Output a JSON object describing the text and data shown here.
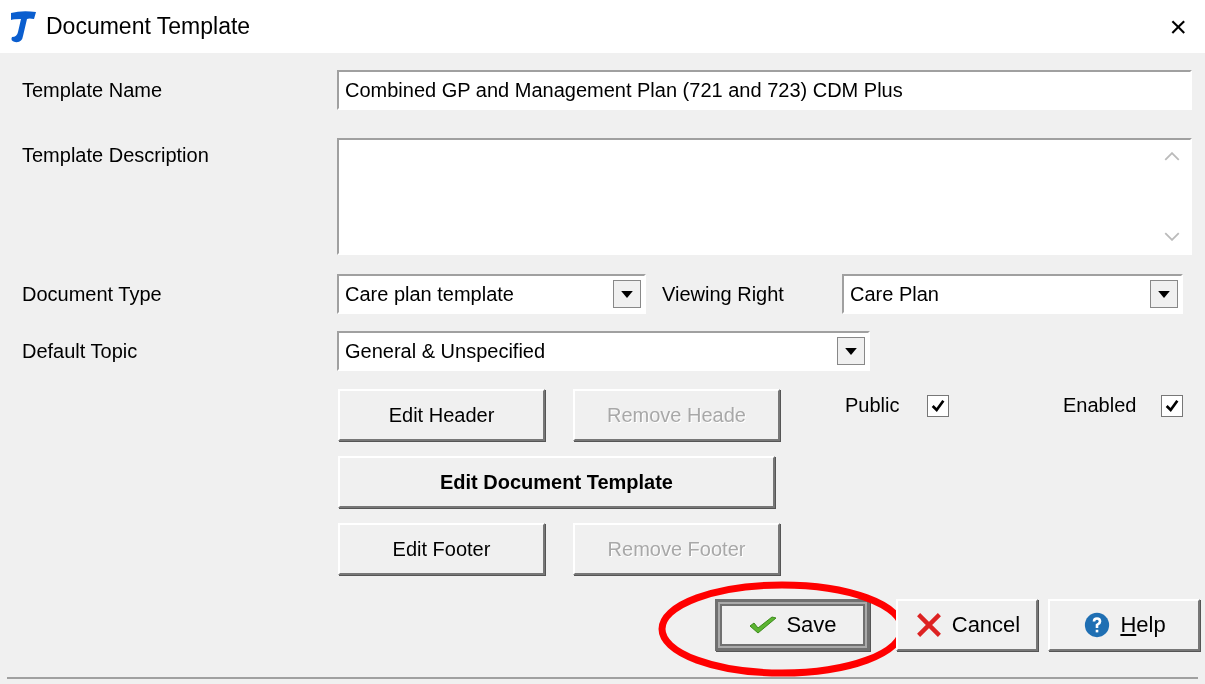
{
  "window": {
    "title": "Document Template",
    "close": "×"
  },
  "template_name": {
    "label": "Template Name",
    "value": "Combined GP and Management Plan (721 and 723) CDM Plus"
  },
  "template_description": {
    "label": "Template Description"
  },
  "document_type": {
    "label": "Document Type",
    "value": "Care plan template"
  },
  "viewing_right": {
    "label": "Viewing Right",
    "value": "Care Plan"
  },
  "default_topic": {
    "label": "Default Topic",
    "value": "General & Unspecified"
  },
  "section_buttons": [
    {
      "kind": "normal",
      "label": "Edit Header",
      "disabled": false
    },
    {
      "kind": "normal",
      "label": "Remove Heade",
      "disabled": true
    },
    {
      "kind": "primary",
      "label": "Edit Document Template",
      "disabled": false
    },
    {
      "kind": "normal",
      "label": "Edit Footer",
      "disabled": false
    },
    {
      "kind": "normal",
      "label": "Remove Footer",
      "disabled": true
    }
  ],
  "checkboxes": [
    {
      "label": "Public",
      "checked": true
    },
    {
      "label": "Enabled",
      "checked": true
    }
  ],
  "action_buttons": [
    {
      "kind": "save",
      "label": "Save",
      "default": true,
      "highlighted": true
    },
    {
      "kind": "cancel",
      "label": "Cancel",
      "default": false,
      "highlighted": false
    },
    {
      "kind": "help",
      "label": "Help",
      "default": false,
      "highlighted": false
    }
  ]
}
